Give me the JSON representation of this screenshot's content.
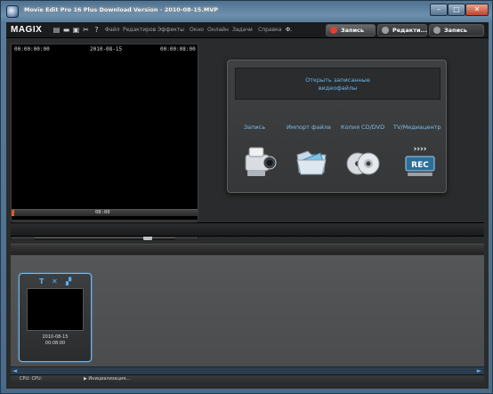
{
  "window": {
    "title": "Movie Edit Pro 16 Plus Download Version - 2010-08-15.MVP",
    "controls": {
      "minimize": "–",
      "maximize": "□",
      "close": "✕"
    }
  },
  "menubar": {
    "logo": "MAGIX",
    "toolbar_icons": [
      "new-file-icon",
      "open-folder-icon",
      "save-icon",
      "cut-icon",
      "help-icon"
    ],
    "menus": [
      "Файл",
      "Редактиров",
      "Эффекты",
      "Окно",
      "Онлайн",
      "Задачи",
      "Справка"
    ],
    "dropdown_glyph": "Ф.",
    "modes": [
      {
        "label": "Запись",
        "color": "#e04030"
      },
      {
        "label": "Редакти...",
        "color": "#9a9ea2"
      },
      {
        "label": "Запись",
        "color": "#9a9ea2"
      }
    ]
  },
  "monitor": {
    "time_left": "00:00:00:00",
    "date": "2010-08-15",
    "time_right": "00:00:08:00",
    "scrub_time": "08:00"
  },
  "transport": {
    "buttons": [
      "⚙",
      "‖",
      "❙❙",
      "◀◀",
      "▐◀",
      "▶",
      "▶▶",
      "▶▌"
    ]
  },
  "import_panel": {
    "open_line1": "Открыть записанные",
    "open_line2": "видеофайлы",
    "options": [
      {
        "label": "Запись",
        "icon": "camcorder-icon"
      },
      {
        "label": "Импорт файла",
        "icon": "folder-icon"
      },
      {
        "label": "Копия CD/DVD",
        "icon": "disc-icon"
      },
      {
        "label": "TV/Медиацентр",
        "icon": "rec-icon"
      }
    ],
    "rec_badge": "REC",
    "rec_arrows": "››››"
  },
  "storyboard": {
    "clip": {
      "date": "2010-08-15",
      "duration": "00:08:00",
      "icons": [
        "T",
        "✕",
        "▞"
      ]
    }
  },
  "statusbar": {
    "cpu": "CPU: CPU:",
    "init": "▶ Инициализация..."
  },
  "scroll": {
    "left": "◄",
    "right": "►"
  }
}
